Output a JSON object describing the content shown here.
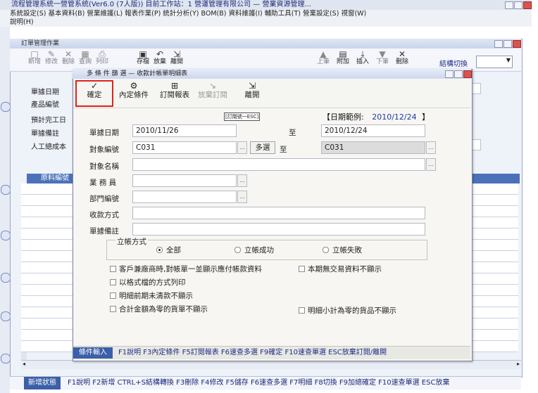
{
  "app": {
    "title": "流程管理系統一營管系統(Ver6.0 (7人版)) 目前工作站：1 營運管理有限公司 — 營業資源管理...",
    "menu": "系統設定(S) 基本資料(B) 營業維護(L) 報表作業(P) 統計分析(Y) BOM(B) 資料維護(I) 輔助工具(T) 營業設定(S) 視窗(W)",
    "menu2": "說明(H)",
    "colors": {
      "accent": "#3b5fa8",
      "highlight": "#e0231c",
      "header": "#4b72b8"
    }
  },
  "inner": {
    "title": "訂單管理作業",
    "toolbar": [
      {
        "icon": "new-icon",
        "label": "新增"
      },
      {
        "icon": "edit-icon",
        "label": "修改"
      },
      {
        "icon": "delete-icon",
        "label": "刪除"
      },
      {
        "icon": "query-icon",
        "label": "查詢"
      },
      {
        "icon": "print-icon",
        "label": "列印"
      },
      {
        "icon": "save-icon",
        "label": "存檔"
      },
      {
        "icon": "undo-icon",
        "label": "放棄"
      },
      {
        "icon": "exit-icon",
        "label": "離開"
      },
      {
        "icon": "prev-icon",
        "label": "上筆"
      },
      {
        "icon": "add-item-icon",
        "label": "附加"
      },
      {
        "icon": "insert-icon",
        "label": "插入"
      },
      {
        "icon": "next-icon",
        "label": "下筆"
      },
      {
        "icon": "close-icon",
        "label": "刪除"
      }
    ],
    "switch_label": "結構切換",
    "fields": [
      "單據日期",
      "產品編號",
      "預計完工日",
      "單據備註",
      "人工總成本"
    ],
    "grid_header": "原料編號",
    "bottom_tag": "新增狀態",
    "bottom_text": "F1說明 F2新增 CTRL+S結構轉換 F3刪除 F4修改 F5儲存 F6速查多選 F7明細 F8切換 F9加總確定 F10速查單選 ESC放棄"
  },
  "dialog": {
    "title": "多 條 件 篩 選 — 收款計帳單明細表",
    "toolbar": {
      "confirm": {
        "icon": "check-icon",
        "label": "確定"
      },
      "preset": {
        "icon": "preset-icon",
        "label": "內定條件"
      },
      "order_report": {
        "icon": "report-icon",
        "label": "訂閱報表"
      },
      "cancel_order": {
        "icon": "cancel-order-icon",
        "label": "放棄訂閱"
      },
      "leave": {
        "icon": "exit-icon",
        "label": "離開"
      }
    },
    "order_badge": "[訂閱號一ESC]",
    "date_range_label": "【日期範例:",
    "date_range_value": "2010/12/24",
    "date_range_close": "】",
    "to_label": "至",
    "multi_select": "多選",
    "fields": {
      "doc_date": {
        "label": "單據日期",
        "from": "2010/11/26",
        "to": "2010/12/24"
      },
      "target_no": {
        "label": "對象編號",
        "from": "C031",
        "to": "C031"
      },
      "target_name": {
        "label": "對象名稱",
        "value": ""
      },
      "salesman": {
        "label": "業 務 員",
        "value": ""
      },
      "dept_no": {
        "label": "部門編號",
        "value": ""
      },
      "payment": {
        "label": "收款方式",
        "value": ""
      },
      "doc_note": {
        "label": "單據備註",
        "value": ""
      }
    },
    "status_group": {
      "label": "立帳方式",
      "options": [
        {
          "label": "全部",
          "checked": true
        },
        {
          "label": "立帳成功",
          "checked": false
        },
        {
          "label": "立帳失敗",
          "checked": false
        }
      ]
    },
    "checkboxes": [
      "客戶兼廠商時,對帳單一並顯示應付帳款資料",
      "以格式檔的方式列印",
      "明細前期未清款不顯示",
      "合計金額為零的貨單不顯示",
      "本期無交易資料不顯示",
      "明細小計為零的貨品不顯示"
    ],
    "status_tag": "條件輸入",
    "status_text": "F1說明 F3內定條件 F5訂閱報表 F6速查多選 F9確定 F10速查單選 ESC放棄訂閱/離開"
  }
}
